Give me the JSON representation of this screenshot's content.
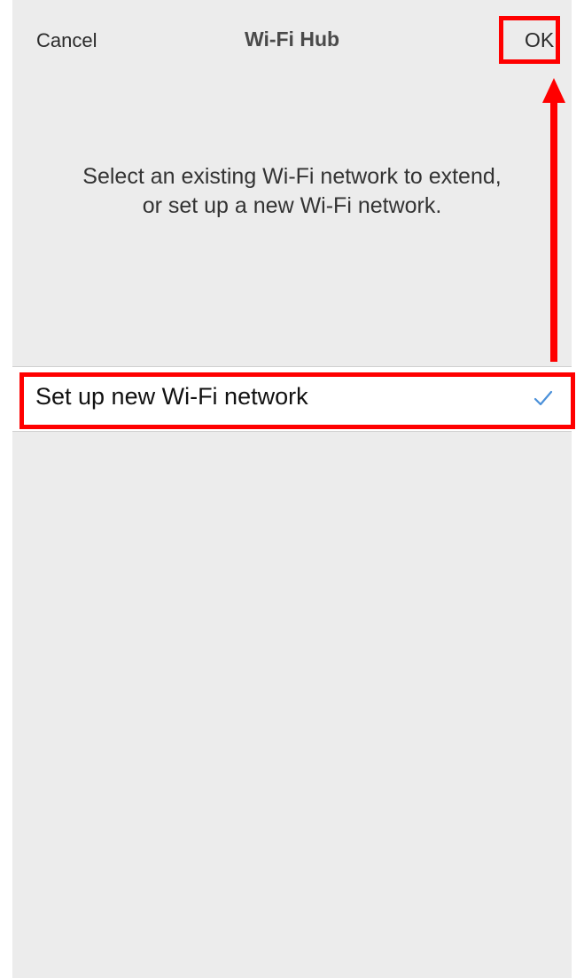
{
  "nav": {
    "cancel_label": "Cancel",
    "title": "Wi-Fi Hub",
    "ok_label": "OK"
  },
  "prompt": {
    "line1": "Select an existing Wi-Fi network to extend,",
    "line2": "or set up a new Wi-Fi network."
  },
  "networks": [
    {
      "label": "Set up new Wi-Fi network",
      "selected": true,
      "icon": "checkmark-icon"
    }
  ],
  "colors": {
    "background": "#ececec",
    "row_background": "#ffffff",
    "checkmark": "#4a90d9",
    "annotation": "#ff0000"
  }
}
